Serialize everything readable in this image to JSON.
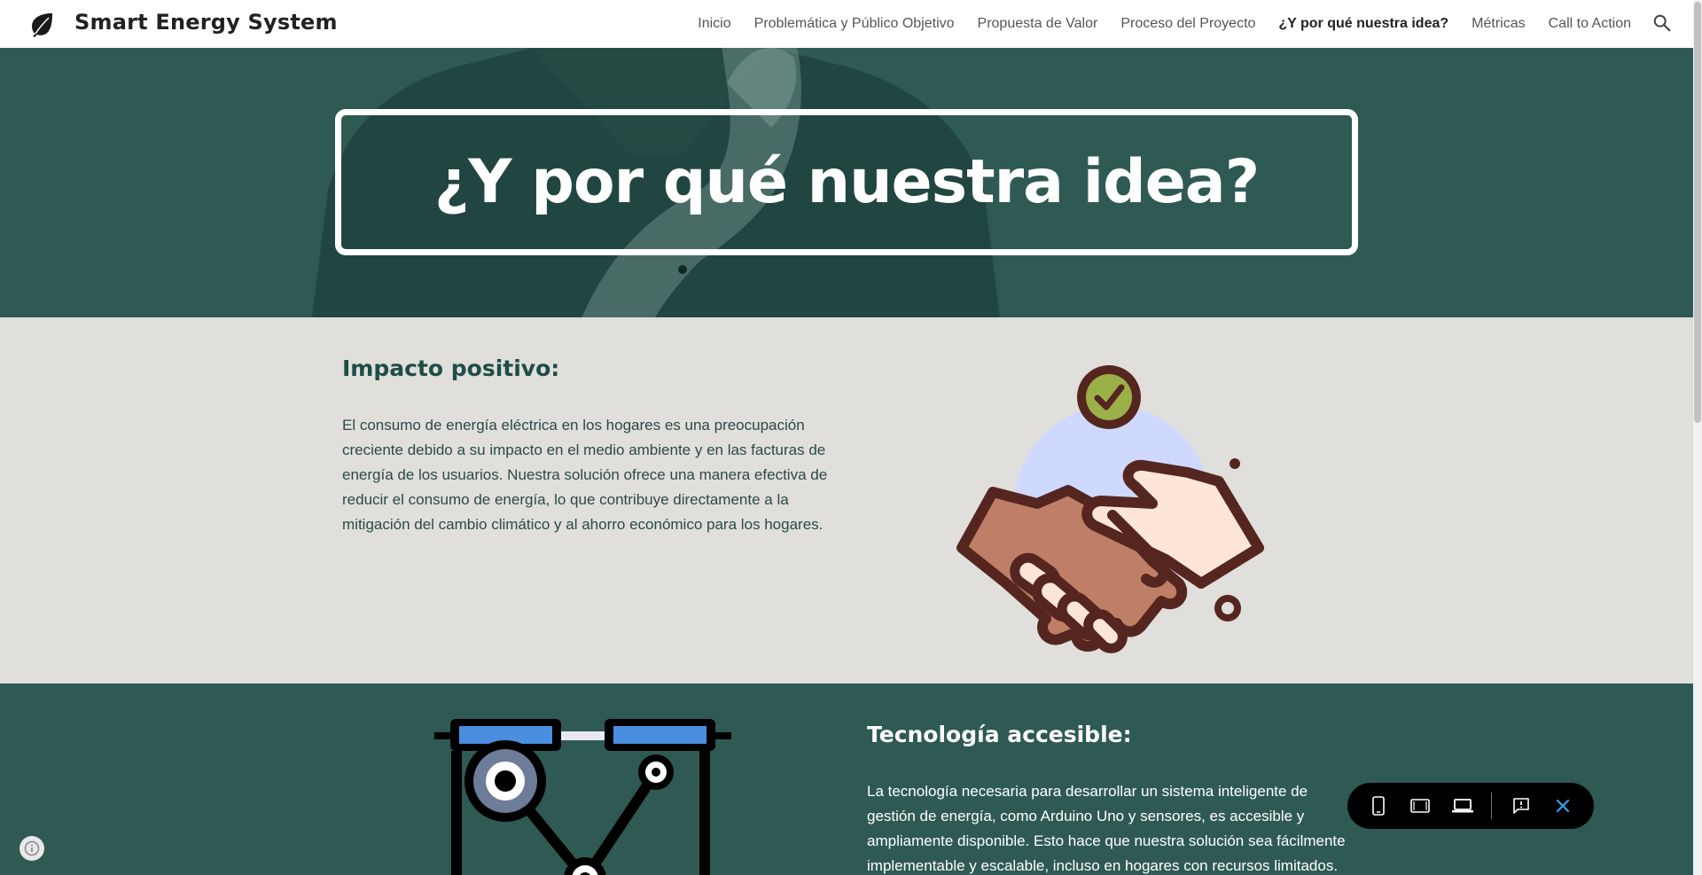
{
  "header": {
    "site_title": "Smart Energy System",
    "logo_icon": "leaf-icon",
    "nav": [
      {
        "label": "Inicio"
      },
      {
        "label": "Problemática y Público Objetivo"
      },
      {
        "label": "Propuesta de Valor"
      },
      {
        "label": "Proceso del Proyecto"
      },
      {
        "label": "¿Y por qué nuestra idea?",
        "active": true
      },
      {
        "label": "Métricas"
      },
      {
        "label": "Call to Action"
      }
    ],
    "search_icon": "search-icon"
  },
  "hero": {
    "title": "¿Y por qué nuestra idea?"
  },
  "section_impact": {
    "heading": "Impacto positivo:",
    "text": "El consumo de energía eléctrica en los hogares es una preocupación creciente debido a su impacto en el medio ambiente y en las facturas de energía de los usuarios. Nuestra solución ofrece una manera efectiva de reducir el consumo de energía, lo que contribuye directamente a la mitigación del cambio climático y al ahorro económico para los hogares.",
    "illustration": "handshake-check-illustration"
  },
  "section_tech": {
    "heading": "Tecnología accesible:",
    "text": "La tecnología necesaria para desarrollar un sistema inteligente de gestión de energía, como Arduino Uno y sensores, es accesible y ampliamente disponible. Esto hace que nuestra solución sea fácilmente implementable y escalable, incluso en hogares con recursos limitados.",
    "illustration": "machine-illustration"
  },
  "preview_toolbar": {
    "icons": [
      "phone-icon",
      "tablet-icon",
      "laptop-icon",
      "feedback-icon",
      "close-icon"
    ]
  },
  "colors": {
    "primary_dark": "#2f5a54",
    "section_light": "#e0dfdb",
    "heading_green": "#1e4d46"
  }
}
